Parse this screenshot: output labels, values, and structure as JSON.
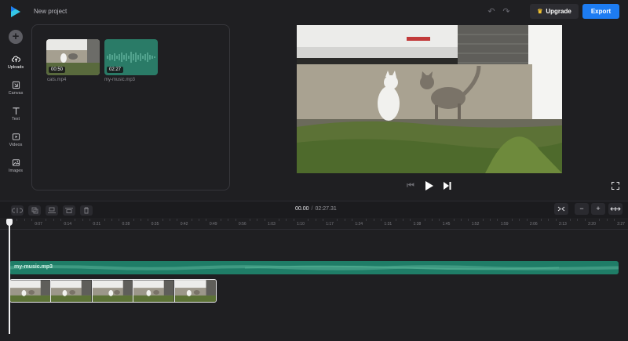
{
  "header": {
    "project_title": "New project",
    "upgrade_label": "Upgrade",
    "export_label": "Export"
  },
  "sidebar": {
    "items": [
      {
        "label": "Uploads",
        "icon": "upload-cloud-icon",
        "active": true
      },
      {
        "label": "Canvas",
        "icon": "canvas-icon"
      },
      {
        "label": "Text",
        "icon": "text-icon"
      },
      {
        "label": "Videos",
        "icon": "video-icon"
      },
      {
        "label": "Images",
        "icon": "image-icon"
      }
    ]
  },
  "media": {
    "items": [
      {
        "name": "cats.mp4",
        "duration": "00:50",
        "type": "video"
      },
      {
        "name": "my-music.mp3",
        "duration": "02:27",
        "type": "audio"
      }
    ]
  },
  "timeline": {
    "current_time": "00.00",
    "total_time": "02:27.31",
    "ruler_ticks": [
      "0",
      "0:07",
      "0:14",
      "0:21",
      "0:28",
      "0:35",
      "0:42",
      "0:49",
      "0:56",
      "1:03",
      "1:10",
      "1:17",
      "1:24",
      "1:31",
      "1:38",
      "1:45",
      "1:52",
      "1:59",
      "2:06",
      "2:13",
      "2:20",
      "2:27"
    ],
    "audio_clip_label": "my-music.mp3",
    "zoom_out": "−",
    "zoom_in": "+"
  },
  "colors": {
    "accent": "#1d7cf2",
    "audio_track": "#1f7d67",
    "background": "#1f1f22"
  }
}
